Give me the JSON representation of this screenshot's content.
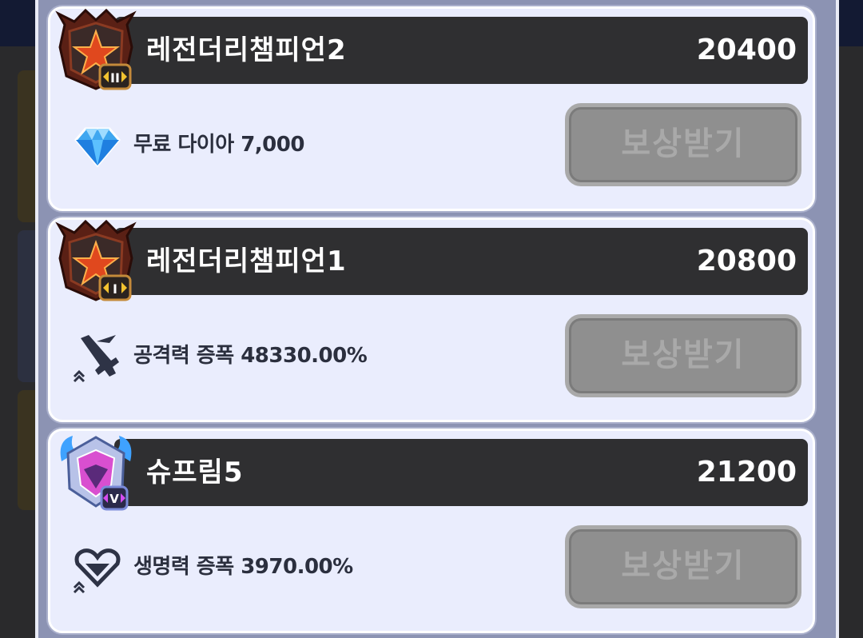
{
  "colors": {
    "panel_bg": "#8c93b3",
    "card_bg": "#eaedfd",
    "header_bg": "#2f2f31",
    "button_disabled_bg": "#8f8f8f",
    "button_disabled_text": "#a9a9a9",
    "reward_text": "#2b2f3e"
  },
  "rewards": [
    {
      "tier_name": "레전더리챔피언2",
      "score": "20400",
      "emblem_icon": "legendary-champion-emblem-icon",
      "emblem_badge": "II",
      "reward_icon": "diamond-icon",
      "reward_text": "무료 다이아 7,000",
      "button_label": "보상받기"
    },
    {
      "tier_name": "레전더리챔피언1",
      "score": "20800",
      "emblem_icon": "legendary-champion-emblem-icon",
      "emblem_badge": "I",
      "reward_icon": "attack-boost-icon",
      "reward_text": "공격력 증폭 48330.00%",
      "button_label": "보상받기"
    },
    {
      "tier_name": "슈프림5",
      "score": "21200",
      "emblem_icon": "supreme-emblem-icon",
      "emblem_badge": "V",
      "reward_icon": "health-boost-icon",
      "reward_text": "생명력 증폭 3970.00%",
      "button_label": "보상받기"
    }
  ]
}
